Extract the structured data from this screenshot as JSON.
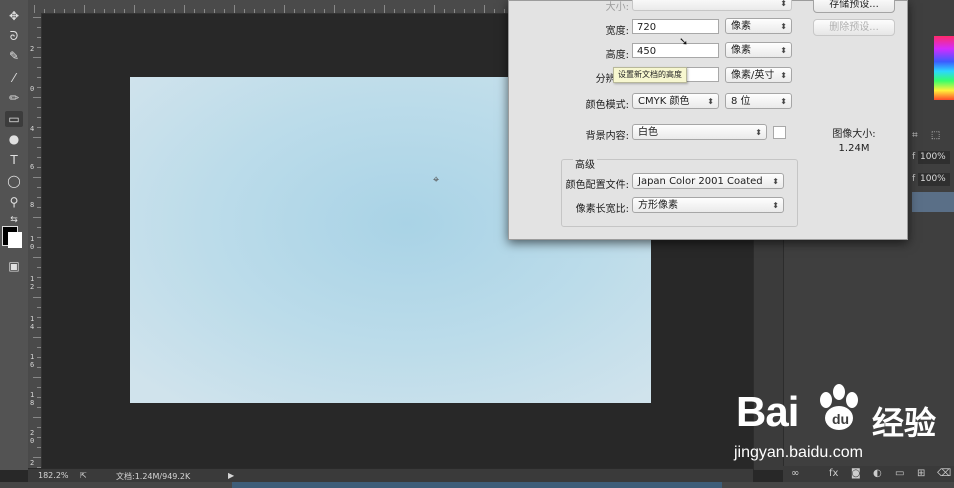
{
  "canvas": {
    "crosshair_glyph": "⌖"
  },
  "ruler_left_numbers": [
    "2",
    "0",
    "4",
    "6",
    "8",
    "1 0",
    "1 2",
    "1 4",
    "1 6",
    "1 8",
    "2 0",
    "2 2"
  ],
  "status": {
    "zoom": "182.2%",
    "doc": "文档:1.24M/949.2K"
  },
  "panels": {
    "pct1": "100%",
    "pct2": "100%",
    "f_letter1": "f",
    "f_letter2": "f"
  },
  "dialog": {
    "size_label": "大小:",
    "width_label": "宽度:",
    "width_value": "720",
    "width_unit": "像素",
    "height_label": "高度:",
    "height_value": "450",
    "height_unit": "像素",
    "resolution_label": "分辨率:",
    "resolution_unit": "像素/英寸",
    "color_mode_label": "颜色模式:",
    "color_mode_value": "CMYK 颜色",
    "bit_depth": "8 位",
    "bg_label": "背景内容:",
    "bg_value": "白色",
    "advanced_label": "高级",
    "profile_label": "颜色配置文件:",
    "profile_value": "Japan Color 2001 Coated",
    "aspect_label": "像素长宽比:",
    "aspect_value": "方形像素",
    "save_preset_btn": "存储预设...",
    "delete_preset_btn": "删除预设...",
    "image_size_label": "图像大小:",
    "image_size_value": "1.24M",
    "tooltip": "设置新文档的高度"
  },
  "watermark": {
    "brand": "Bai",
    "brand_cn": "经验",
    "url": "jingyan.baidu.com"
  },
  "colors": {
    "canvas_center": "#a9d3e6",
    "canvas_edge": "#d0e3ec",
    "app_bg": "#282828",
    "dialog_bg": "#e3e3e3",
    "selected_layer": "#5a6f87"
  },
  "icons": [
    "move-icon",
    "lasso-icon",
    "quick-select-icon",
    "eyedropper-icon",
    "brush-icon",
    "gradient-icon",
    "dodge-icon",
    "type-icon",
    "ellipse-icon",
    "zoom-icon",
    "swap-colors-icon",
    "screen-mode-icon",
    "cursor-arrow-icon",
    "baidu-paw-icon"
  ]
}
